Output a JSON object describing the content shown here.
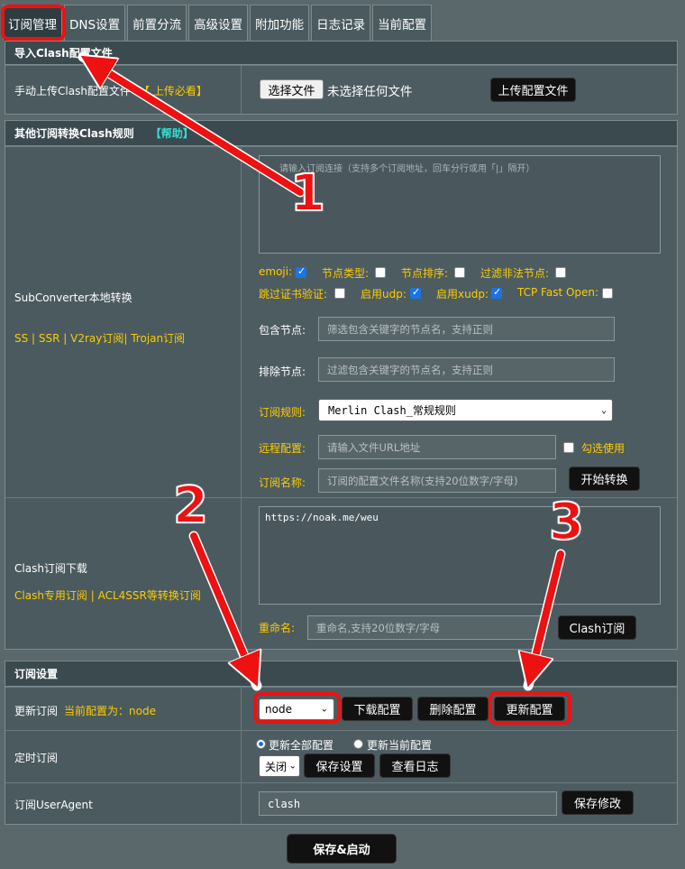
{
  "tabs": [
    "订阅管理",
    "DNS设置",
    "前置分流",
    "高级设置",
    "附加功能",
    "日志记录",
    "当前配置"
  ],
  "import_section": {
    "header": "导入Clash配置文件",
    "label": "手动上传Clash配置文件",
    "label_link": "【 上传必看】",
    "choose_btn": "选择文件",
    "no_file": "未选择任何文件",
    "upload_btn": "上传配置文件"
  },
  "convert_section": {
    "header": "其他订阅转换Clash规则",
    "help": "【帮助】",
    "left_title": "SubConverter本地转换",
    "left_sub": "SS | SSR | V2ray订阅| Trojan订阅",
    "textarea_placeholder": "请输入订阅连接（支持多个订阅地址，回车分行或用「|」隔开）",
    "options_row1": [
      {
        "label": "emoji:",
        "checked": true
      },
      {
        "label": "节点类型:",
        "checked": false
      },
      {
        "label": "节点排序:",
        "checked": false
      },
      {
        "label": "过滤非法节点:",
        "checked": false
      }
    ],
    "options_row2": [
      {
        "label": "跳过证书验证:",
        "checked": false
      },
      {
        "label": "启用udp:",
        "checked": true
      },
      {
        "label": "启用xudp:",
        "checked": true
      },
      {
        "label": "TCP Fast Open:",
        "checked": false
      }
    ],
    "include_label": "包含节点:",
    "include_placeholder": "筛选包含关键字的节点名，支持正则",
    "exclude_label": "排除节点:",
    "exclude_placeholder": "过滤包含关键字的节点名，支持正则",
    "rule_label": "订阅规则:",
    "rule_value": "Merlin Clash_常规规则",
    "remote_label": "远程配置:",
    "remote_placeholder": "请输入文件URL地址",
    "remote_check": "勾选使用",
    "name_label": "订阅名称:",
    "name_placeholder": "订阅的配置文件名称(支持20位数字/字母)",
    "start_btn": "开始转换"
  },
  "download_section": {
    "left_title": "Clash订阅下载",
    "left_sub": "Clash专用订阅 | ACL4SSR等转换订阅",
    "textarea_value": "https://noak.me/weu",
    "rename_label": "重命名:",
    "rename_placeholder": "重命名,支持20位数字/字母",
    "btn": "Clash订阅"
  },
  "sub_settings": {
    "header": "订阅设置",
    "update_label": "更新订阅",
    "current_label": "当前配置为：node",
    "select_value": "node",
    "download_btn": "下载配置",
    "delete_btn": "删除配置",
    "update_btn": "更新配置",
    "timer_label": "定时订阅",
    "radio_all": "更新全部配置",
    "radio_current": "更新当前配置",
    "timer_value": "关闭",
    "save_setting_btn": "保存设置",
    "view_log_btn": "查看日志",
    "ua_label": "订阅UserAgent",
    "ua_value": "clash",
    "save_change_btn": "保存修改"
  },
  "save_start_btn": "保存&启动",
  "annotations": [
    "1",
    "2",
    "3"
  ],
  "colors": {
    "highlight": "#ee1111",
    "accent_yellow": "#ffcc00",
    "accent_cyan": "#33e0d6"
  }
}
